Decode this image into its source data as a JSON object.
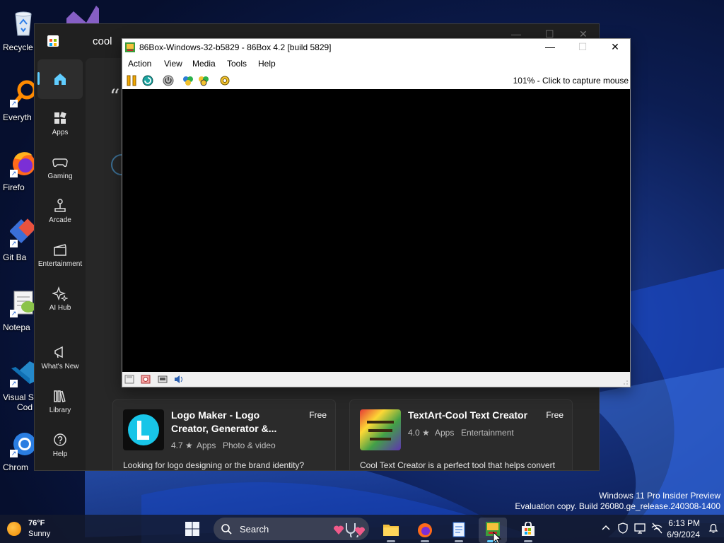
{
  "desktop": {
    "icons": [
      {
        "label": "Recycle",
        "icon": "recycle-bin-icon"
      },
      {
        "label": "Everyth",
        "icon": "everything-search-icon"
      },
      {
        "label": "Firefo",
        "icon": "firefox-icon"
      },
      {
        "label": "Git Ba",
        "icon": "git-bash-icon"
      },
      {
        "label": "Notepa",
        "icon": "notepad-plus-plus-icon"
      },
      {
        "label": "Visual St",
        "label2": "Cod",
        "icon": "vscode-icon"
      },
      {
        "label": "Chrom",
        "icon": "chrome-icon"
      }
    ]
  },
  "store": {
    "search_value": "cool",
    "nav": [
      {
        "label": "",
        "icon": "home-icon"
      },
      {
        "label": "Apps",
        "icon": "apps-icon"
      },
      {
        "label": "Gaming",
        "icon": "gamepad-icon"
      },
      {
        "label": "Arcade",
        "icon": "joystick-icon"
      },
      {
        "label": "Entertainment",
        "icon": "clapperboard-icon"
      },
      {
        "label": "AI Hub",
        "icon": "sparkle-icon"
      },
      {
        "label": "What's New",
        "icon": "megaphone-icon"
      },
      {
        "label": "Library",
        "icon": "library-icon"
      },
      {
        "label": "Help",
        "icon": "help-icon"
      }
    ],
    "quote_char": "“",
    "results": [
      {
        "name": "Logo Maker - Logo Creator, Generator &...",
        "price": "Free",
        "rating": "4.7 ★",
        "category": "Apps",
        "subcategory": "Photo & video",
        "description": "Looking for logo designing or the brand identity?"
      },
      {
        "name": "TextArt-Cool Text Creator",
        "price": "Free",
        "rating": "4.0 ★",
        "category": "Apps",
        "subcategory": "Entertainment",
        "description": "Cool Text Creator is a perfect tool that helps convert"
      }
    ]
  },
  "box86": {
    "title": "86Box-Windows-32-b5829 - 86Box 4.2 [build 5829]",
    "caption_buttons": {
      "minimize": "—",
      "maximize": "☐",
      "close": "✕"
    },
    "menu": [
      "Action",
      "View",
      "Media",
      "Tools",
      "Help"
    ],
    "toolbar_icons": [
      "pause-icon",
      "reset-icon",
      "power-icon",
      "ctrl-alt-del-icon",
      "ctrl-alt-esc-icon",
      "settings-icon"
    ],
    "capture_hint": "101% - Click to capture mouse",
    "status_icons": [
      "floppy-icon",
      "cdrom-icon",
      "network-icon",
      "sound-icon"
    ]
  },
  "watermark": {
    "line1": "Windows 11 Pro Insider Preview",
    "line2": "Evaluation copy. Build 26080.ge_release.240308-1400"
  },
  "taskbar": {
    "weather_temp": "76°F",
    "weather_condition": "Sunny",
    "search_placeholder": "Search",
    "apps": [
      "file-explorer-icon",
      "firefox-icon",
      "notepad-icon",
      "86box-icon",
      "microsoft-store-icon"
    ],
    "tray_icons": [
      "chevron-up-icon",
      "vpn-shield-icon",
      "display-icon",
      "network-off-icon",
      "notification-bell-icon"
    ],
    "time": "6:13 PM",
    "date": "6/9/2024"
  },
  "colors": {
    "accent": "#60cdff",
    "store_bg": "#202020",
    "box86_screen": "#000000"
  }
}
